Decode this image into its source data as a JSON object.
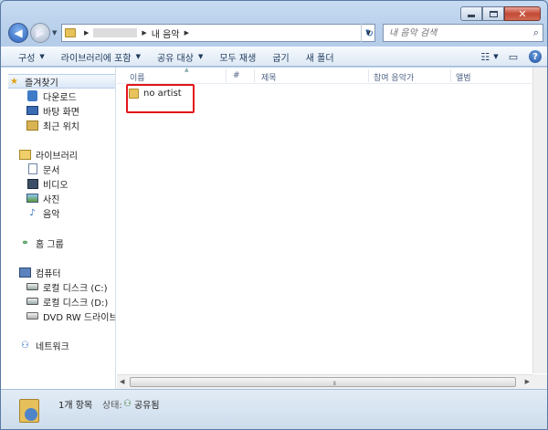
{
  "window": {
    "caption_buttons": {
      "minimize": "minimize",
      "maximize": "maximize",
      "close": "✕"
    }
  },
  "address": {
    "crumb": "내 음악",
    "search_placeholder": "내 음악 검색"
  },
  "toolbar": {
    "items": [
      "구성",
      "라이브러리에 포함",
      "공유 대상",
      "모두 재생",
      "굽기",
      "새 폴더"
    ]
  },
  "sidebar": {
    "favorites": "즐겨찾기",
    "favorites_items": [
      "다운로드",
      "바탕 화면",
      "최근 위치"
    ],
    "libraries": "라이브러리",
    "libraries_items": [
      "문서",
      "비디오",
      "사진",
      "음악"
    ],
    "homegroup": "홈 그룹",
    "computer": "컴퓨터",
    "computer_items": [
      "로컬 디스크 (C:)",
      "로컬 디스크 (D:)",
      "DVD RW 드라이브 ("
    ],
    "network": "네트워크"
  },
  "columns": [
    "이름",
    "#",
    "제목",
    "참여 음악가",
    "앨범"
  ],
  "files": [
    {
      "name": "no artist"
    }
  ],
  "status": {
    "count": "1개 항목",
    "state_label": "상태:",
    "state_value": "공유됨"
  },
  "colors": {
    "highlight": "#e3151a",
    "accent": "#2a5fb8"
  }
}
